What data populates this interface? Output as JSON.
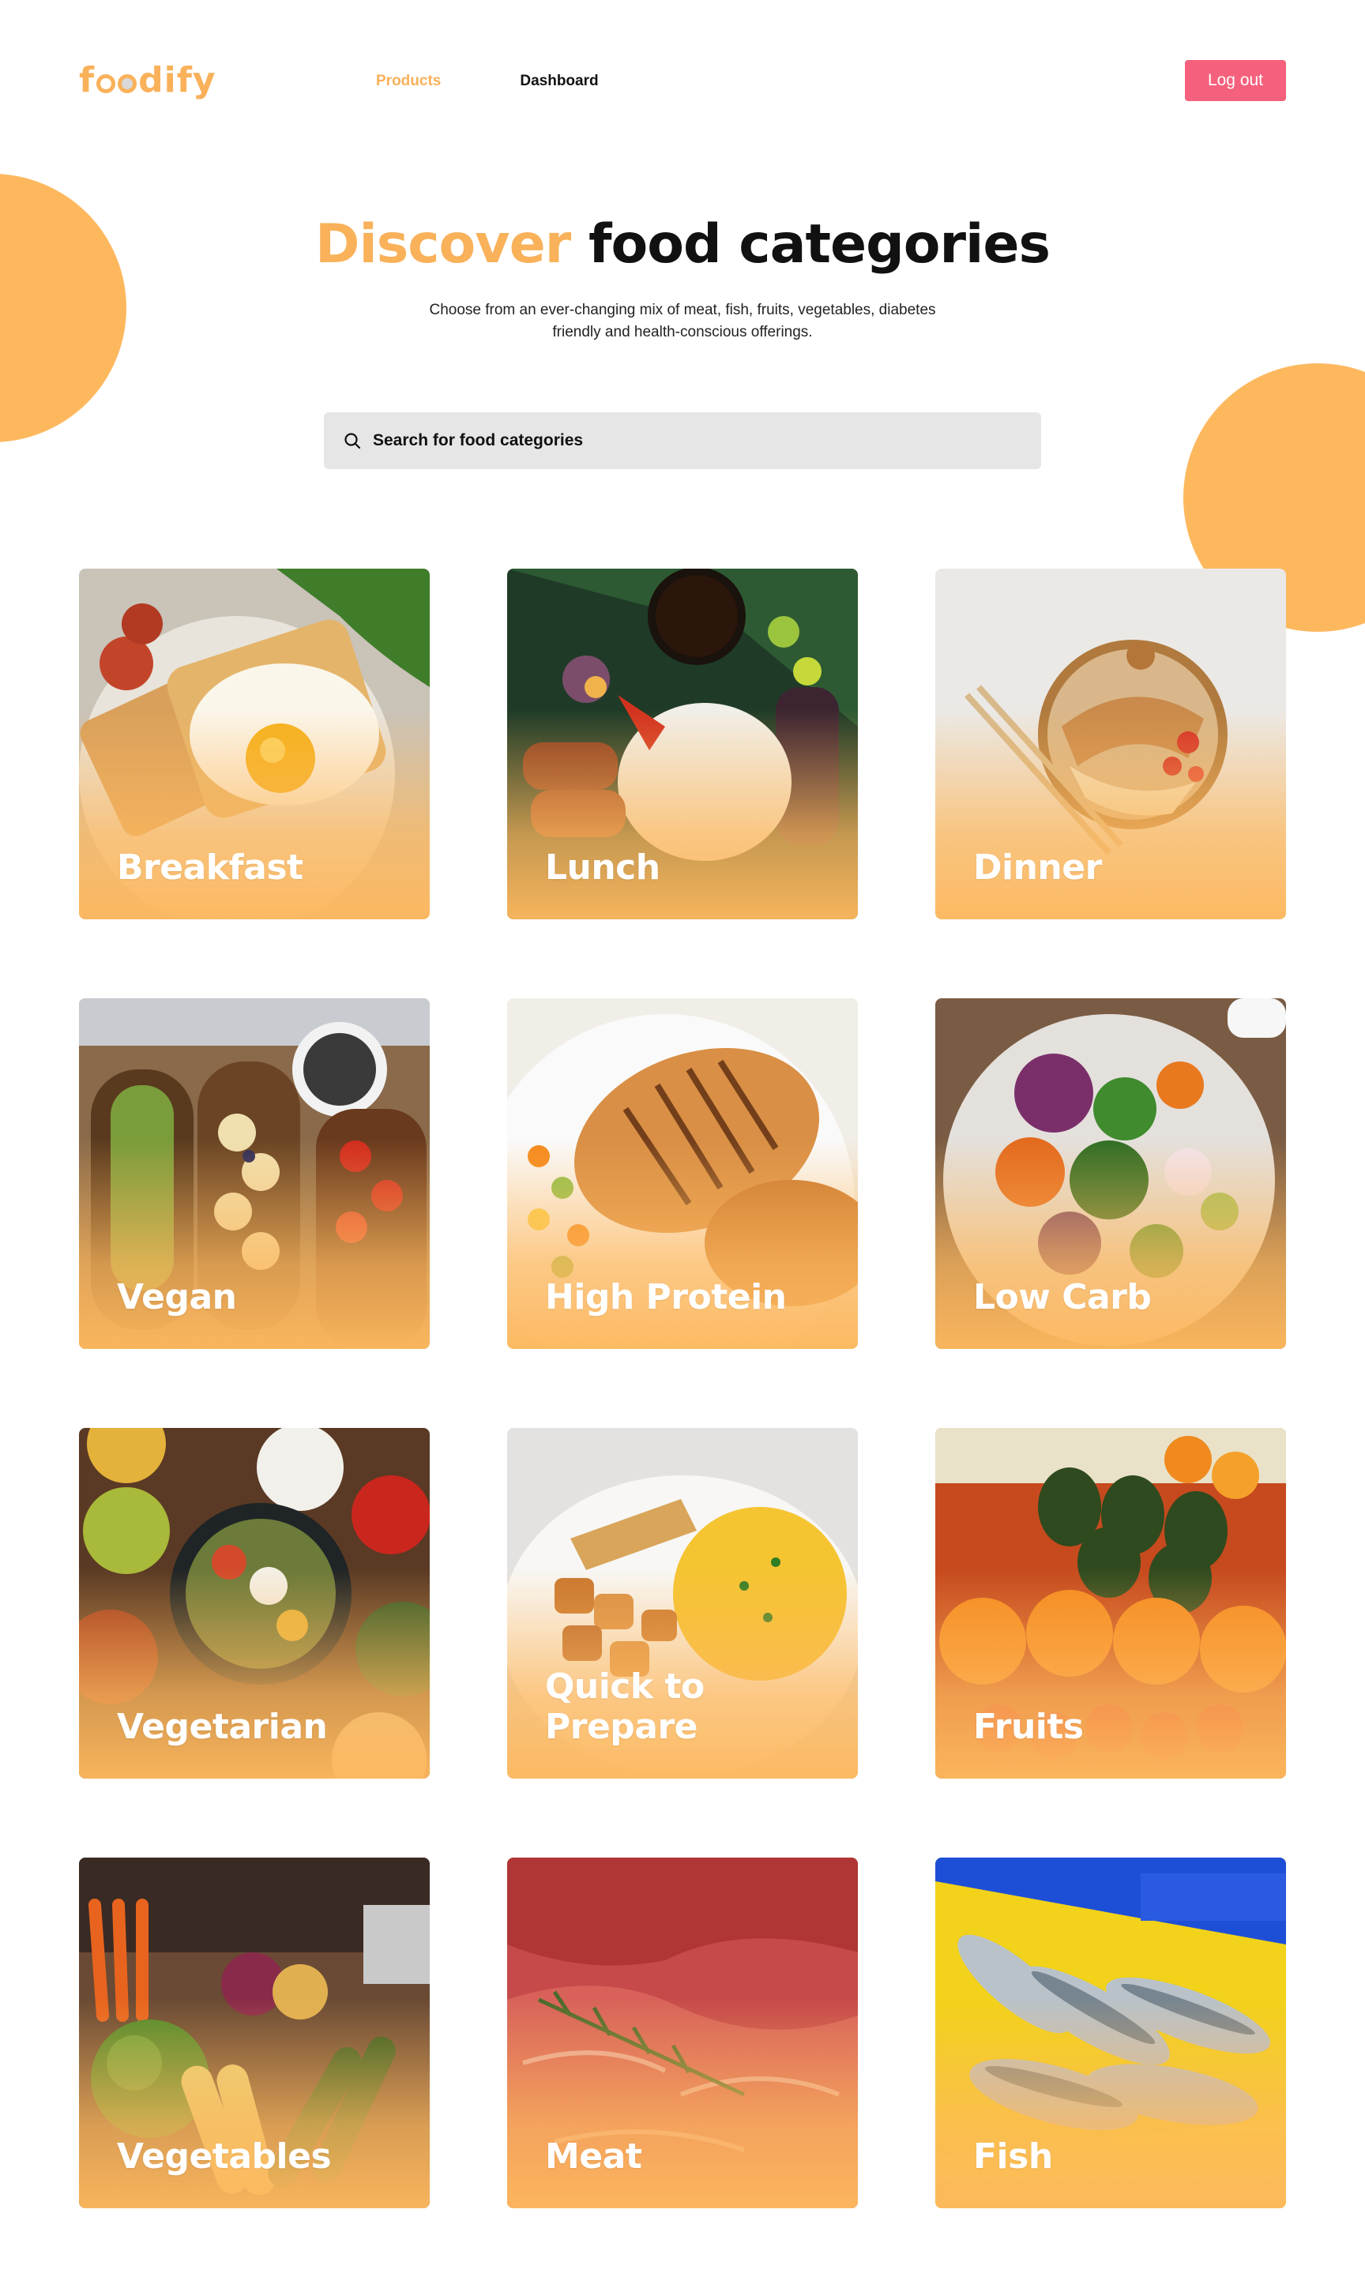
{
  "brand": {
    "name": "foodify"
  },
  "nav": {
    "products": "Products",
    "dashboard": "Dashboard",
    "logout": "Log out"
  },
  "hero": {
    "title_accent": "Discover",
    "title_rest": "food categories",
    "subtitle": "Choose from an ever-changing mix of meat, fish, fruits, vegetables, diabetes friendly and health-conscious offerings."
  },
  "search": {
    "placeholder": "Search for food categories",
    "icon": "search-icon"
  },
  "categories": [
    {
      "label": "Breakfast"
    },
    {
      "label": "Lunch"
    },
    {
      "label": "Dinner"
    },
    {
      "label": "Vegan"
    },
    {
      "label": "High Protein"
    },
    {
      "label": "Low Carb"
    },
    {
      "label": "Vegetarian"
    },
    {
      "label": "Quick to Prepare"
    },
    {
      "label": "Fruits"
    },
    {
      "label": "Vegetables"
    },
    {
      "label": "Meat"
    },
    {
      "label": "Fish"
    }
  ],
  "colors": {
    "accent": "#F9B15A",
    "blob": "#FDB85E",
    "logout": "#F5617C",
    "search_bg": "#E6E6E6"
  }
}
